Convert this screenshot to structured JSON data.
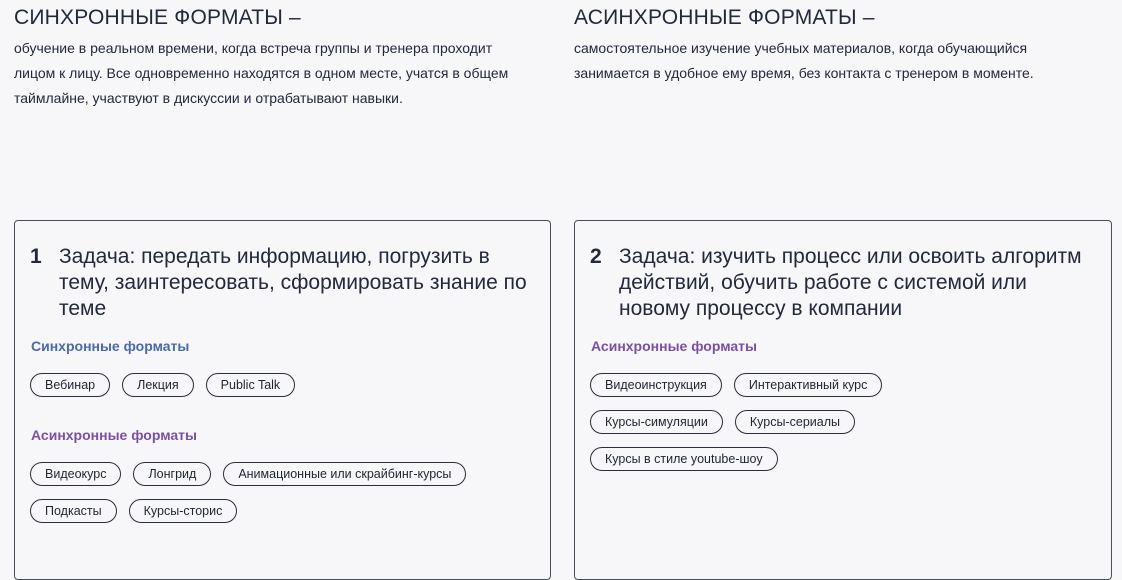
{
  "intro": {
    "sync": {
      "title": "СИНХРОННЫЕ ФОРМАТЫ –",
      "text": "обучение в реальном времени, когда встреча группы и тренера проходит лицом к лицу. Все одновременно находятся в одном месте, учатся в общем таймлайне, участвуют в дискуссии и отрабатывают навыки."
    },
    "async": {
      "title": "АСИНХРОННЫЕ ФОРМАТЫ –",
      "text": "самостоятельное изучение учебных материалов, когда обучающийся занимается в удобное ему время, без контакта с тренером в моменте."
    }
  },
  "cards": {
    "first": {
      "number": "1",
      "task": "Задача: передать информацию, погрузить в тему, заинтересовать, сформировать знание по теме",
      "sync_title": "Синхронные форматы",
      "sync_chips": [
        "Вебинар",
        "Лекция",
        "Public Talk"
      ],
      "async_title": "Асинхронные форматы",
      "async_chips": [
        "Видеокурс",
        "Лонгрид",
        "Анимационные или скрайбинг-курсы",
        "Подкасты",
        "Курсы-сторис"
      ]
    },
    "second": {
      "number": "2",
      "task": "Задача: изучить процесс или освоить алгоритм действий, обучить работе с системой или новому процессу в компании",
      "async_title": "Асинхронные форматы",
      "async_chips": [
        "Видеоинструкция",
        "Интерактивный курс",
        "Курсы-симуляции",
        "Курсы-сериалы",
        "Курсы в стиле youtube-шоу"
      ]
    }
  },
  "colors": {
    "sync_accent": "#4a6aa8",
    "async_accent": "#7b50a3",
    "text": "#23283a",
    "background": "#f7f7fa",
    "border": "#4b4f5a"
  }
}
